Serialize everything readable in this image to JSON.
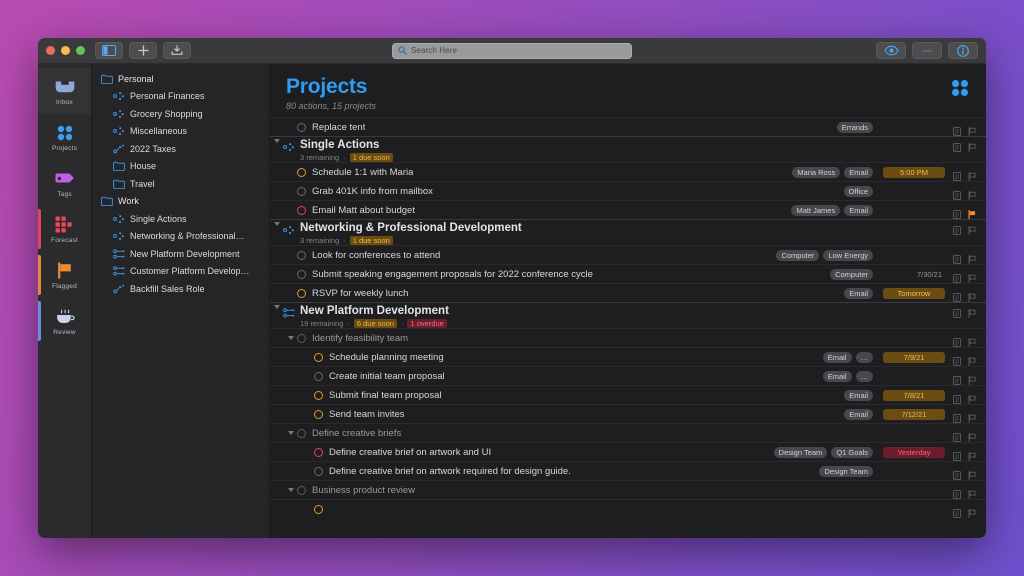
{
  "window": {
    "titlebar": {
      "traffic_lights": [
        "close",
        "minimize",
        "zoom"
      ],
      "sidebar_toggle_label": "sidebar-toggle",
      "add_label": "add",
      "inbox_label": "inbox",
      "view_label": "view-options",
      "share_label": "share",
      "inspector_label": "inspector"
    },
    "search": {
      "placeholder": "Search Here",
      "value": ""
    }
  },
  "rail": {
    "items": [
      {
        "label": "Inbox",
        "icon": "inbox-icon",
        "stripe": "",
        "selected": false
      },
      {
        "label": "Projects",
        "icon": "projects-icon",
        "stripe": "",
        "selected": false
      },
      {
        "label": "Tags",
        "icon": "tags-icon",
        "stripe": "",
        "selected": false
      },
      {
        "label": "Forecast",
        "icon": "forecast-icon",
        "stripe": "#e2445c",
        "selected": false
      },
      {
        "label": "Flagged",
        "icon": "flag-icon",
        "stripe": "#e08a3c",
        "selected": false
      },
      {
        "label": "Review",
        "icon": "review-icon",
        "stripe": "#6f8ce0",
        "selected": false
      }
    ]
  },
  "sidebar": {
    "items": [
      {
        "label": "Personal",
        "icon": "folder-icon",
        "child": false
      },
      {
        "label": "Personal Finances",
        "icon": "project-dots-icon",
        "child": true
      },
      {
        "label": "Grocery Shopping",
        "icon": "project-dots-icon",
        "child": true
      },
      {
        "label": "Miscellaneous",
        "icon": "project-dots-icon",
        "child": true
      },
      {
        "label": "2022 Taxes",
        "icon": "project-chain-icon",
        "child": true
      },
      {
        "label": "House",
        "icon": "folder-icon",
        "child": true
      },
      {
        "label": "Travel",
        "icon": "folder-icon",
        "child": true
      },
      {
        "label": "Work",
        "icon": "folder-icon",
        "child": false
      },
      {
        "label": "Single Actions",
        "icon": "project-dots-icon",
        "child": true
      },
      {
        "label": "Networking & Professional…",
        "icon": "project-dots-icon",
        "child": true
      },
      {
        "label": "New Platform Development",
        "icon": "project-seq-icon",
        "child": true
      },
      {
        "label": "Customer Platform Develop…",
        "icon": "project-seq-icon",
        "child": true
      },
      {
        "label": "Backfill Sales Role",
        "icon": "project-chain-icon",
        "child": true
      }
    ]
  },
  "main": {
    "title": "Projects",
    "subtitle": "80 actions, 15 projects",
    "perspective_icon": "projects-dots-icon",
    "rows": [
      {
        "kind": "task",
        "indent": 1,
        "label": "Replace tent",
        "status": "none",
        "tags": [
          "Errands"
        ],
        "due": "",
        "due_state": "",
        "flagged": false
      },
      {
        "kind": "group",
        "indent": 0,
        "label": "Single Actions",
        "icon": "project-dots-icon",
        "remaining": "3 remaining",
        "badges": [
          {
            "text": "1 due soon",
            "state": "soon"
          }
        ]
      },
      {
        "kind": "task",
        "indent": 1,
        "label": "Schedule 1:1 with Maria",
        "status": "soon",
        "tags": [
          "Maria Ross",
          "Email"
        ],
        "due": "5:00 PM",
        "due_state": "soon",
        "flagged": false
      },
      {
        "kind": "task",
        "indent": 1,
        "label": "Grab 401K info from mailbox",
        "status": "none",
        "tags": [
          "Office"
        ],
        "due": "",
        "due_state": "",
        "flagged": false
      },
      {
        "kind": "task",
        "indent": 1,
        "label": "Email Matt about budget",
        "status": "over",
        "tags": [
          "Matt James",
          "Email"
        ],
        "due": "",
        "due_state": "",
        "flagged": true
      },
      {
        "kind": "group",
        "indent": 0,
        "label": "Networking & Professional Development",
        "icon": "project-dots-icon",
        "remaining": "3 remaining",
        "badges": [
          {
            "text": "1 due soon",
            "state": "soon"
          }
        ]
      },
      {
        "kind": "task",
        "indent": 1,
        "label": "Look for conferences to attend",
        "status": "none",
        "tags": [
          "Computer",
          "Low Energy"
        ],
        "due": "",
        "due_state": "",
        "flagged": false
      },
      {
        "kind": "task",
        "indent": 1,
        "label": "Submit speaking engagement proposals for 2022 conference cycle",
        "status": "none",
        "tags": [
          "Computer"
        ],
        "due": "7/30/21",
        "due_state": "plain",
        "flagged": false
      },
      {
        "kind": "task",
        "indent": 1,
        "label": "RSVP for weekly lunch",
        "status": "soon",
        "tags": [
          "Email"
        ],
        "due": "Tomorrow",
        "due_state": "soon",
        "flagged": false
      },
      {
        "kind": "group",
        "indent": 0,
        "label": "New Platform Development",
        "icon": "project-seq-icon",
        "remaining": "19 remaining",
        "badges": [
          {
            "text": "6 due soon",
            "state": "soon"
          },
          {
            "text": "1 overdue",
            "state": "over"
          }
        ]
      },
      {
        "kind": "subgroup",
        "indent": 1,
        "label": "Identify feasibility team",
        "status": "grp"
      },
      {
        "kind": "task",
        "indent": 2,
        "label": "Schedule planning meeting",
        "status": "soon",
        "tags": [
          "Email",
          "…"
        ],
        "due": "7/9/21",
        "due_state": "soon",
        "flagged": false
      },
      {
        "kind": "task",
        "indent": 2,
        "label": "Create initial team proposal",
        "status": "none",
        "tags": [
          "Email",
          "…"
        ],
        "due": "",
        "due_state": "",
        "flagged": false
      },
      {
        "kind": "task",
        "indent": 2,
        "label": "Submit final team proposal",
        "status": "soon",
        "tags": [
          "Email"
        ],
        "due": "7/8/21",
        "due_state": "soon",
        "flagged": false
      },
      {
        "kind": "task",
        "indent": 2,
        "label": "Send team invites",
        "status": "soon",
        "tags": [
          "Email"
        ],
        "due": "7/12/21",
        "due_state": "soon",
        "flagged": false
      },
      {
        "kind": "subgroup",
        "indent": 1,
        "label": "Define creative briefs",
        "status": "grp"
      },
      {
        "kind": "task",
        "indent": 2,
        "label": "Define creative brief on artwork and UI",
        "status": "over",
        "tags": [
          "Design Team",
          "Q1 Goals"
        ],
        "due": "Yesterday",
        "due_state": "over",
        "flagged": false
      },
      {
        "kind": "task",
        "indent": 2,
        "label": "Define creative brief on artwork required for design guide.",
        "status": "none",
        "tags": [
          "Design Team"
        ],
        "due": "",
        "due_state": "",
        "flagged": false
      },
      {
        "kind": "subgroup",
        "indent": 1,
        "label": "Business product review",
        "status": "grp"
      },
      {
        "kind": "task",
        "indent": 2,
        "label": "",
        "status": "soon",
        "tags": [],
        "due": "",
        "due_state": "",
        "flagged": false
      }
    ]
  },
  "colors": {
    "accent_blue": "#2f9bf5",
    "due_soon": "#e09a2e",
    "overdue": "#e2445c",
    "flag_orange": "#e8822e",
    "desktop_gradient_start": "#b94bb0",
    "desktop_gradient_end": "#6f50cc"
  }
}
